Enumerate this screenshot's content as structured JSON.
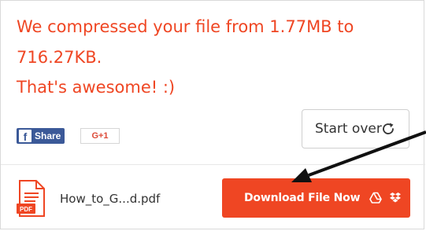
{
  "message": {
    "line1": "We compressed your file from 1.77MB to",
    "line2": "716.27KB.",
    "line3": "That's awesome! :)"
  },
  "social": {
    "facebook_label": "Share",
    "facebook_glyph": "f",
    "gplus_label": "G+1"
  },
  "start_over": {
    "label": "Start over",
    "icon": "refresh-icon"
  },
  "file": {
    "name": "How_to_G...d.pdf",
    "type_badge": "PDF"
  },
  "download": {
    "label": "Download File Now",
    "icons": [
      "google-drive-icon",
      "dropbox-icon"
    ]
  },
  "colors": {
    "accent": "#ef4623",
    "facebook": "#3b5998",
    "gplus": "#dd4b39"
  }
}
